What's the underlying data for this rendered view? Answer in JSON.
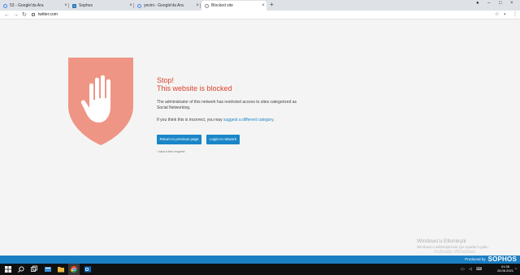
{
  "browser": {
    "tabs": [
      {
        "title": "53 - Google'da Ara",
        "favicon": "google-icon",
        "active": false
      },
      {
        "title": "Sophos",
        "favicon": "sophos-icon",
        "active": false
      },
      {
        "title": "yevini - Google'da Ara",
        "favicon": "google-icon",
        "active": false
      },
      {
        "title": "Blocked site",
        "favicon": "blocked-site-icon",
        "active": true
      }
    ],
    "new_tab": "+",
    "url": "twitter.com"
  },
  "block_page": {
    "stop": "Stop!",
    "headline": "This website is blocked",
    "description": "The administrator of this network has restricted access to sites categorized as Social Networking.",
    "incorrect_prefix": "If you think this is incorrect, you may ",
    "incorrect_link": "suggest a different category",
    "incorrect_suffix": ".",
    "return_button": "Return to previous page",
    "login_button": "Login to network",
    "about_link": "About this request",
    "produced_by": "Produced by",
    "brand": "SOPHOS"
  },
  "watermark": {
    "line1": "Windows'u Etkinleştir",
    "line2": "Windows'u etkinleştirmek için Ayarlar'a gidin.",
    "line3": "Activate Windows",
    "line4": "Go to Settings to activate Windows."
  },
  "taskbar": {
    "time": "01:36",
    "date": "26.06.2021"
  },
  "colors": {
    "accent": "#1a86c8",
    "alert": "#d9442e",
    "shield": "#ef9585"
  }
}
